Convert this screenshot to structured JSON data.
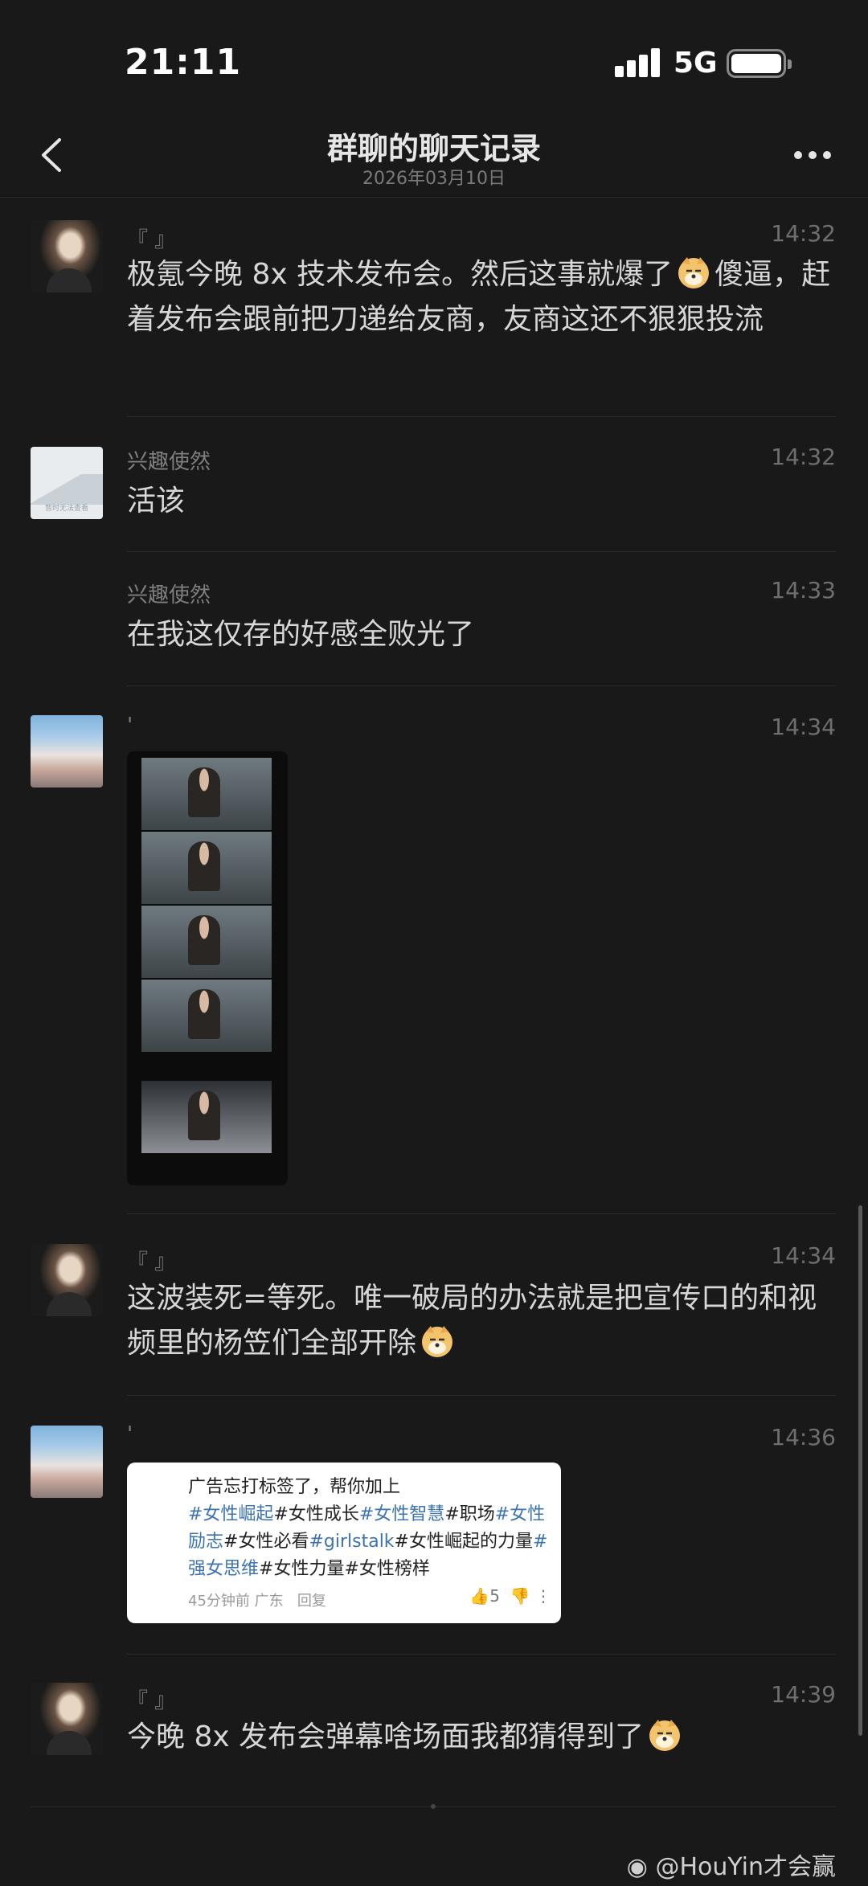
{
  "status_bar": {
    "time": "21:11",
    "network": "5G"
  },
  "nav": {
    "title": "群聊的聊天记录",
    "subtitle": "2026年03月10日"
  },
  "messages": [
    {
      "sender": "『 』",
      "time": "14:32",
      "text_a": "极氪今晚 8x 技术发布会。然后这事就爆了",
      "text_b": "傻逼，赶着发布会跟前把刀递给友商，友商这还不狠狠投流"
    },
    {
      "sender": "兴趣使然",
      "time": "14:32",
      "text": "活该",
      "avatar_caption": "暂时无法查看"
    },
    {
      "sender": "兴趣使然",
      "time": "14:33",
      "text": "在我这仅存的好感全败光了"
    },
    {
      "sender": "'",
      "time": "14:34"
    },
    {
      "sender": "『 』",
      "time": "14:34",
      "text": "这波装死=等死。唯一破局的办法就是把宣传口的和视频里的杨笠们全部开除"
    },
    {
      "sender": "'",
      "time": "14:36",
      "card": {
        "line1": "广告忘打标签了，帮你加上",
        "tags": [
          "#女性崛起",
          "#女性成长",
          "#女性智慧",
          "#职场",
          "#女性励志",
          "#女性必看",
          "#girlstalk",
          "#女性崛起的力量",
          "#强女思维",
          "#女性力量",
          "#女性榜样"
        ],
        "meta": "45分钟前 广东",
        "reply": "回复",
        "likes": "5"
      }
    },
    {
      "sender": "『 』",
      "time": "14:39",
      "text": "今晚 8x 发布会弹幕啥场面我都猜得到了"
    }
  ],
  "watermark": "@HouYin才会赢"
}
